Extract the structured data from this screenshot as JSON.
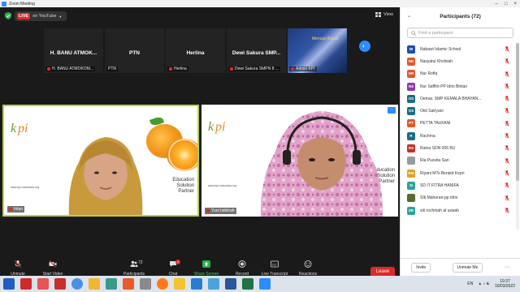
{
  "window": {
    "title": "Zoom Meeting"
  },
  "topbar": {
    "live_badge": "LIVE",
    "live_text": "on YouTube",
    "view_label": "View"
  },
  "thumbnails": [
    {
      "big": "H. BANU ATMOK...",
      "small": "H. BANU ATMOKOM..."
    },
    {
      "big": "PTN",
      "small": "PTN"
    },
    {
      "big": "Herlina",
      "small": "Herlina"
    },
    {
      "big": "Dewi Sakura SMP...",
      "small": "Dewi Sakura SMPN 8 ..."
    },
    {
      "big": "",
      "small": "Admin KPI",
      "slide_title": "Mencari Bakat"
    }
  ],
  "tiles": {
    "left": {
      "name": "Intan",
      "edu_line1": "Education",
      "edu_line2": "Solution",
      "edu_line3": "Partner",
      "url": "www.kpi-indonesia.org",
      "logo_text": "kpi"
    },
    "right": {
      "name": "Yuni Istibhah",
      "edu_line1": "Education",
      "edu_line2": "Solution",
      "edu_line3": "Partner",
      "url": "www.kpi-indonesia.org",
      "logo_text": "kpi"
    }
  },
  "toolbar": {
    "unmute": "Unmute",
    "start_video": "Start Video",
    "participants": "Participants",
    "participants_count": "72",
    "chat": "Chat",
    "chat_badge": "4",
    "share": "Share Screen",
    "record": "Record",
    "transcript": "Live Transcript",
    "reactions": "Reactions",
    "leave": "Leave"
  },
  "panel": {
    "title": "Participants (72)",
    "search_placeholder": "Find a participant",
    "invite": "Invite",
    "unmute_me": "Unmute Me",
    "participants": [
      {
        "initials": "NI",
        "name": "Nabawi Islamic School",
        "color": "#1f4fa3"
      },
      {
        "initials": "NK",
        "name": "Nasyatul Kholisah",
        "color": "#e0582b"
      },
      {
        "initials": "NR",
        "name": "Nur Rofiq",
        "color": "#e0582b"
      },
      {
        "initials": "NS",
        "name": "Nur Saffitri-PP Idris Bintan",
        "color": "#8e3aa8"
      },
      {
        "initials": "OS",
        "name": "Oemar. SMP KEMALA BHAYAN...",
        "color": "#1c6c82"
      },
      {
        "initials": "OS",
        "name": "Okti Satryani",
        "color": "#1c6c82"
      },
      {
        "initials": "PT",
        "name": "PETTA TAUFANI",
        "color": "#e0582b"
      },
      {
        "initials": "R",
        "name": "Rachma",
        "color": "#1c6c82"
      },
      {
        "initials": "RS",
        "name": "Ratna SDN 005 BU",
        "color": "#c4302b"
      },
      {
        "initials": "",
        "name": "Ria Pusvita Sari",
        "color": "#9a9a9a"
      },
      {
        "initials": "RM",
        "name": "Riyani MTs Berakit Kepri",
        "color": "#e0a02b"
      },
      {
        "initials": "SI",
        "name": "SD IT FITRA HANIFA",
        "color": "#2ba39a"
      },
      {
        "initials": "",
        "name": "SIti Maheran-pp idris",
        "color": "#556b2f"
      },
      {
        "initials": "SR",
        "name": "siti rochmah al uswah",
        "color": "#2ba39a"
      }
    ]
  },
  "taskbar": {
    "lang": "EN",
    "time": "19:37",
    "date": "10/03/2022"
  }
}
